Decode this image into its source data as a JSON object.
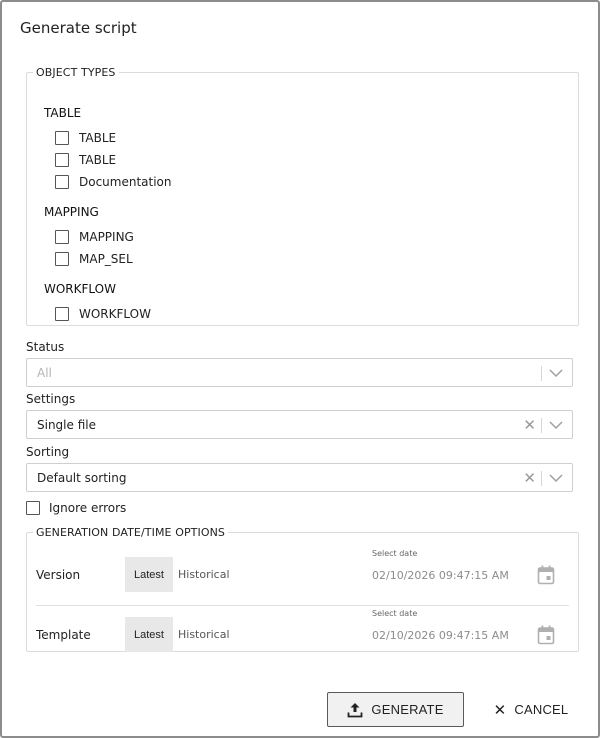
{
  "dialog": {
    "title": "Generate script"
  },
  "object_types": {
    "legend": "OBJECT TYPES",
    "groups": [
      {
        "label": "TABLE",
        "items": [
          {
            "label": "TABLE",
            "checked": false
          },
          {
            "label": "TABLE",
            "checked": false
          },
          {
            "label": "Documentation",
            "checked": false
          }
        ]
      },
      {
        "label": "MAPPING",
        "items": [
          {
            "label": "MAPPING",
            "checked": false
          },
          {
            "label": "MAP_SEL",
            "checked": false
          }
        ]
      },
      {
        "label": "WORKFLOW",
        "items": [
          {
            "label": "WORKFLOW",
            "checked": false
          }
        ]
      }
    ]
  },
  "status": {
    "label": "Status",
    "value": "All"
  },
  "settings": {
    "label": "Settings",
    "value": "Single file"
  },
  "sorting": {
    "label": "Sorting",
    "value": "Default sorting"
  },
  "ignore_errors": {
    "label": "Ignore errors",
    "checked": false
  },
  "generation_options": {
    "legend": "GENERATION DATE/TIME OPTIONS",
    "rows": [
      {
        "label": "Version",
        "latest": "Latest",
        "historical": "Historical",
        "select_date_label": "Select date",
        "date_value": "02/10/2026 09:47:15 AM",
        "icon": "calendar-icon"
      },
      {
        "label": "Template",
        "latest": "Latest",
        "historical": "Historical",
        "select_date_label": "Select date",
        "date_value": "02/10/2026 09:47:15 AM",
        "icon": "calendar-icon"
      }
    ]
  },
  "actions": {
    "generate_label": "GENERATE",
    "generate_icon": "upload-icon",
    "cancel_label": "CANCEL",
    "cancel_icon": "close-icon"
  }
}
